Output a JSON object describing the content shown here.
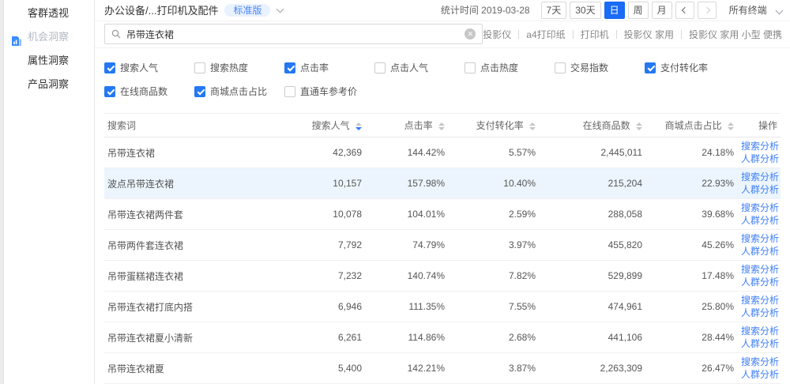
{
  "sidebar": {
    "items": [
      {
        "label": "客群透视",
        "active": false
      },
      {
        "label": "机会洞察",
        "active": true
      },
      {
        "label": "属性洞察",
        "active": false
      },
      {
        "label": "产品洞察",
        "active": false
      }
    ]
  },
  "topbar": {
    "breadcrumb": "办公设备/...打印机及配件",
    "version_badge": "标准版",
    "stat_time": "统计时间 2019-03-28",
    "date_buttons": {
      "d7": "7天",
      "d30": "30天",
      "day": "日",
      "week": "周",
      "month": "月"
    },
    "selected_date_button": "日",
    "terminal_selector": "所有终端"
  },
  "search": {
    "value": "吊带连衣裙",
    "hot_words": [
      "投影仪",
      "a4打印纸",
      "打印机",
      "投影仪 家用",
      "投影仪 家用 小型 便携"
    ]
  },
  "icons": {
    "clear": "✕"
  },
  "filters": {
    "row1": [
      {
        "label": "搜索人气",
        "checked": true
      },
      {
        "label": "搜索热度",
        "checked": false
      },
      {
        "label": "点击率",
        "checked": true
      },
      {
        "label": "点击人气",
        "checked": false
      },
      {
        "label": "点击热度",
        "checked": false
      },
      {
        "label": "交易指数",
        "checked": false
      },
      {
        "label": "支付转化率",
        "checked": true
      }
    ],
    "row2": [
      {
        "label": "在线商品数",
        "checked": true
      },
      {
        "label": "商城点击占比",
        "checked": true
      },
      {
        "label": "直通车参考价",
        "checked": false
      }
    ]
  },
  "table": {
    "columns": {
      "keyword": "搜索词",
      "search_popularity": "搜索人气",
      "click_rate": "点击率",
      "pay_conversion": "支付转化率",
      "online_products": "在线商品数",
      "mall_click_share": "商城点击占比",
      "operation": "操作"
    },
    "sorted_column": "搜索人气",
    "sort_direction": "desc",
    "action_labels": [
      "搜索分析",
      "人群分析"
    ],
    "rows": [
      {
        "keyword": "吊带连衣裙",
        "search_popularity": "42,369",
        "click_rate": "144.42%",
        "pay_conversion": "5.57%",
        "online_products": "2,445,011",
        "mall_click_share": "24.18%"
      },
      {
        "keyword": "波点吊带连衣裙",
        "search_popularity": "10,157",
        "click_rate": "157.98%",
        "pay_conversion": "10.40%",
        "online_products": "215,204",
        "mall_click_share": "22.93%"
      },
      {
        "keyword": "吊带连衣裙两件套",
        "search_popularity": "10,078",
        "click_rate": "104.01%",
        "pay_conversion": "2.59%",
        "online_products": "288,058",
        "mall_click_share": "39.68%"
      },
      {
        "keyword": "吊带两件套连衣裙",
        "search_popularity": "7,792",
        "click_rate": "74.79%",
        "pay_conversion": "3.97%",
        "online_products": "455,820",
        "mall_click_share": "45.26%"
      },
      {
        "keyword": "吊带蛋糕裙连衣裙",
        "search_popularity": "7,232",
        "click_rate": "140.74%",
        "pay_conversion": "7.82%",
        "online_products": "529,899",
        "mall_click_share": "17.48%"
      },
      {
        "keyword": "吊带连衣裙打底内搭",
        "search_popularity": "6,946",
        "click_rate": "111.35%",
        "pay_conversion": "7.55%",
        "online_products": "474,961",
        "mall_click_share": "25.80%"
      },
      {
        "keyword": "吊带连衣裙夏小清新",
        "search_popularity": "6,261",
        "click_rate": "114.86%",
        "pay_conversion": "2.68%",
        "online_products": "441,106",
        "mall_click_share": "28.44%"
      },
      {
        "keyword": "吊带连衣裙夏",
        "search_popularity": "5,400",
        "click_rate": "142.21%",
        "pay_conversion": "3.87%",
        "online_products": "2,263,309",
        "mall_click_share": "26.47%"
      }
    ],
    "highlighted_row_index": 1
  },
  "colors": {
    "accent_blue": "#1a6bf5",
    "link_blue": "#3d7ef8",
    "checkbox_blue": "#2478f2",
    "badge_bg": "#e9f2ff",
    "badge_text": "#4a86f8",
    "row_highlight": "#ecf5fd"
  }
}
